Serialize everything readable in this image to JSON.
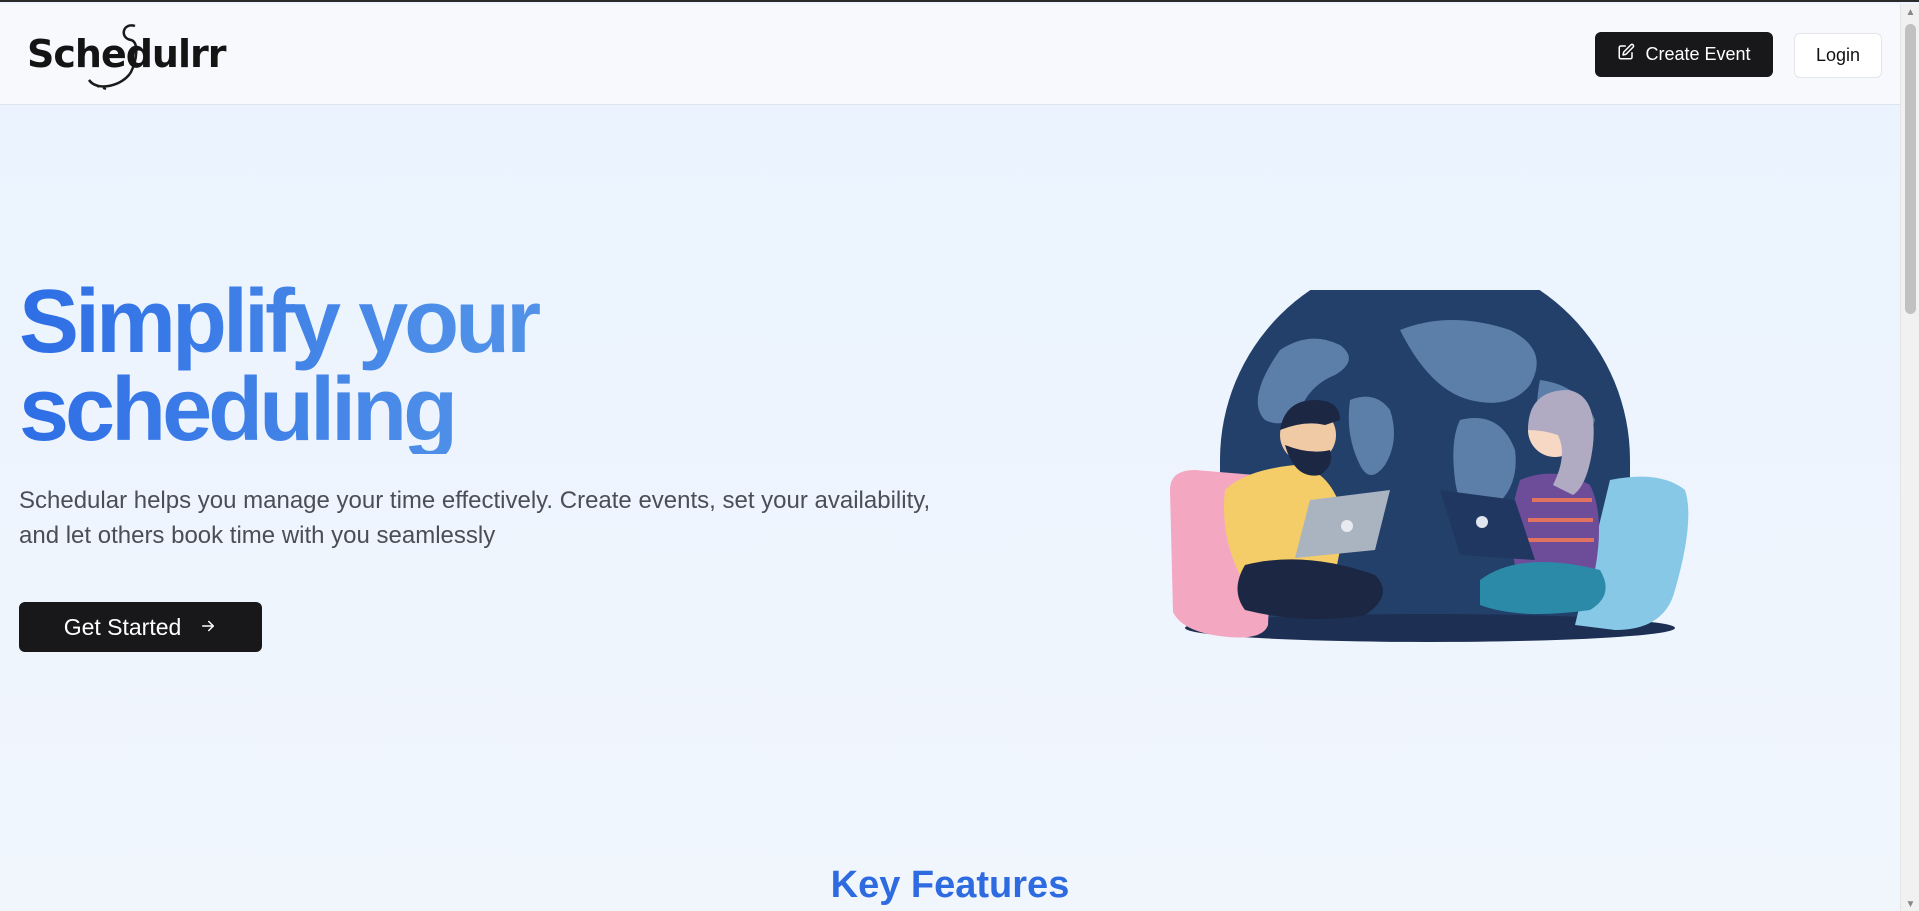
{
  "header": {
    "logo_text": "Schedulrr",
    "create_event_label": "Create Event",
    "login_label": "Login"
  },
  "hero": {
    "title_line1": "Simplify your",
    "title_line2": "scheduling",
    "subtitle": "Schedular helps you manage your time effectively. Create events, set your availability, and let others book time with you seamlessly",
    "cta_label": "Get Started"
  },
  "features": {
    "title": "Key Features"
  },
  "colors": {
    "accent": "#2e6be0",
    "dark_button": "#18181b",
    "background": "#eef5fe"
  },
  "icons": {
    "create_event": "edit-square-icon",
    "cta": "arrow-right-icon"
  }
}
